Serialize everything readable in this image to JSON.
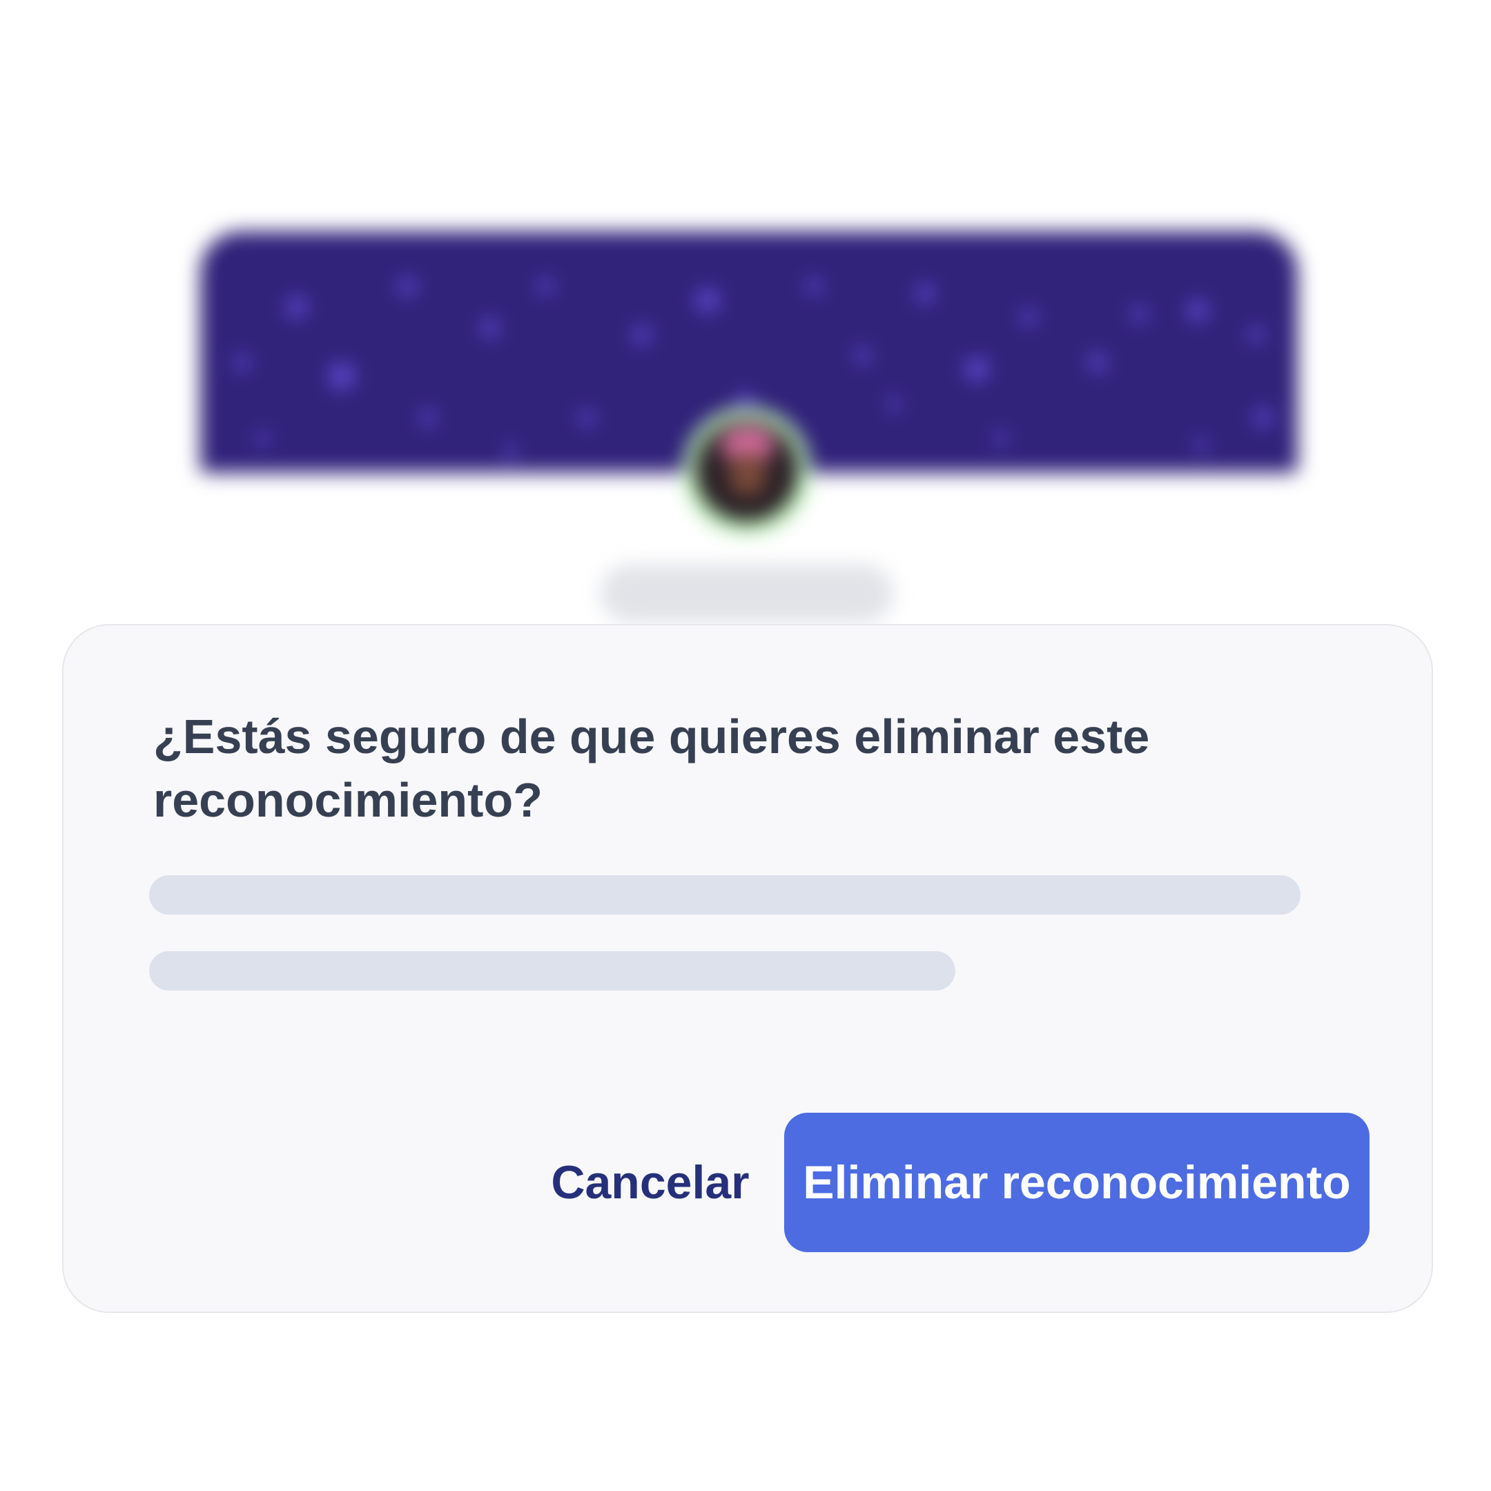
{
  "dialog": {
    "title": "¿Estás seguro de que quieres eliminar este reconocimiento?",
    "cancel_label": "Cancelar",
    "confirm_label": "Eliminar reconocimiento"
  },
  "colors": {
    "banner": "#31227a",
    "banner_dots": "#5b45c9",
    "avatar_ring": "#b9efb4",
    "dialog_background": "#f8f8fa",
    "title_text": "#364052",
    "skeleton": "#dce1ec",
    "cancel_text": "#26307a",
    "confirm_button": "#4d6ce2",
    "confirm_text": "#ffffff"
  }
}
